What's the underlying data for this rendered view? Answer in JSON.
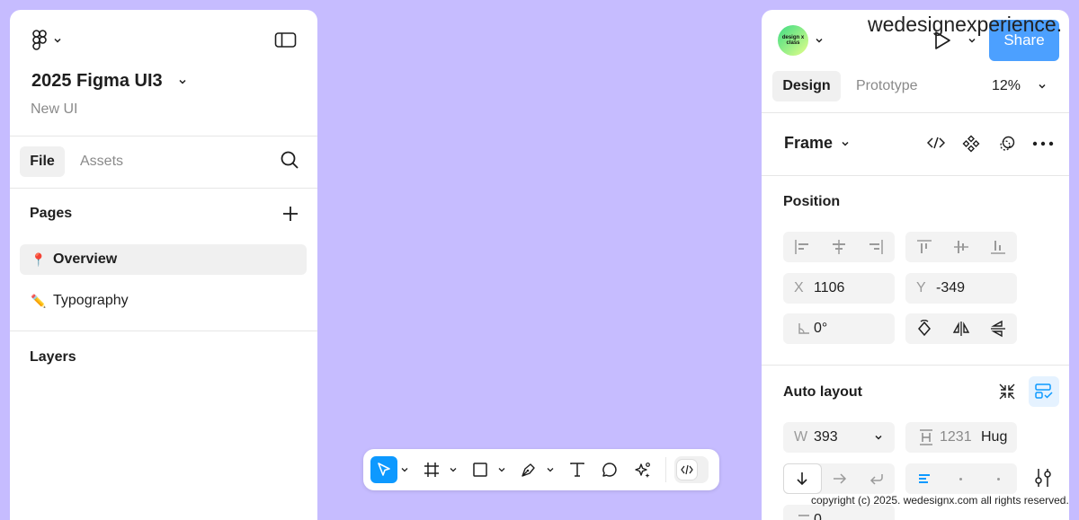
{
  "file": {
    "name": "2025 Figma UI3",
    "subtitle": "New UI"
  },
  "left_tabs": {
    "file": "File",
    "assets": "Assets"
  },
  "pages": {
    "title": "Pages",
    "items": [
      {
        "emoji": "📍",
        "label": "Overview",
        "active": true
      },
      {
        "emoji": "✏️",
        "label": "Typography",
        "active": false
      }
    ]
  },
  "layers": {
    "title": "Layers"
  },
  "header": {
    "share_label": "Share",
    "avatar_text": "design x class",
    "zoom": "12%"
  },
  "right_tabs": {
    "design": "Design",
    "prototype": "Prototype"
  },
  "frame": {
    "label": "Frame"
  },
  "position": {
    "title": "Position",
    "x_label": "X",
    "x_value": "1106",
    "y_label": "Y",
    "y_value": "-349",
    "rotation": "0°"
  },
  "auto_layout": {
    "title": "Auto layout",
    "w_label": "W",
    "w_value": "393",
    "h_value": "1231",
    "h_mode": "Hug",
    "gap_value": "0"
  },
  "watermark": "wedesignexperience.",
  "copyright": "copyright (c) 2025. wedesignx.com  all rights reserved.",
  "colors": {
    "canvas": "#c6bcff",
    "accent": "#0d99ff",
    "share": "#4ca0ff"
  }
}
